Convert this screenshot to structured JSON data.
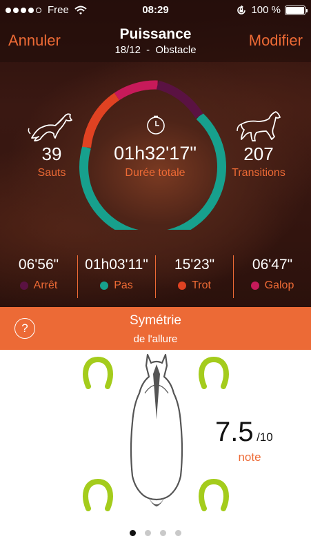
{
  "status_bar": {
    "carrier": "Free",
    "time": "08:29",
    "battery": "100 %",
    "signal_bars": 4
  },
  "nav": {
    "cancel_label": "Annuler",
    "edit_label": "Modifier",
    "title": "Puissance",
    "date": "18/12",
    "separator": "-",
    "type": "Obstacle"
  },
  "summary": {
    "total_duration": "01h32'17\"",
    "total_label": "Durée totale",
    "jumps_value": "39",
    "jumps_label": "Sauts",
    "transitions_value": "207",
    "transitions_label": "Transitions",
    "jump_icon": "jumping-horse-icon",
    "trot_icon": "trotting-horse-icon",
    "clock_icon": "clock-icon"
  },
  "gaits": [
    {
      "time": "06'56\"",
      "label": "Arrêt",
      "color": "#5a1242"
    },
    {
      "time": "01h03'11\"",
      "label": "Pas",
      "color": "#17a08d"
    },
    {
      "time": "15'23\"",
      "label": "Trot",
      "color": "#e04222"
    },
    {
      "time": "06'47\"",
      "label": "Galop",
      "color": "#c71a5a"
    }
  ],
  "ring_colors": {
    "arret": "#5a1242",
    "pas": "#17a08d",
    "trot": "#e04222",
    "galop": "#c71a5a"
  },
  "symmetry": {
    "title": "Symétrie",
    "subtitle": "de l'allure",
    "help_label": "?",
    "score": "7.5",
    "score_max": "/10",
    "score_label": "note",
    "shoe_color": "#a4cc1c",
    "horseshoe_icon": "horseshoe-icon",
    "horse_icon": "horse-top-view-icon"
  },
  "pager": {
    "pages": 4,
    "active": 1
  },
  "colors": {
    "accent": "#ec6a36"
  }
}
